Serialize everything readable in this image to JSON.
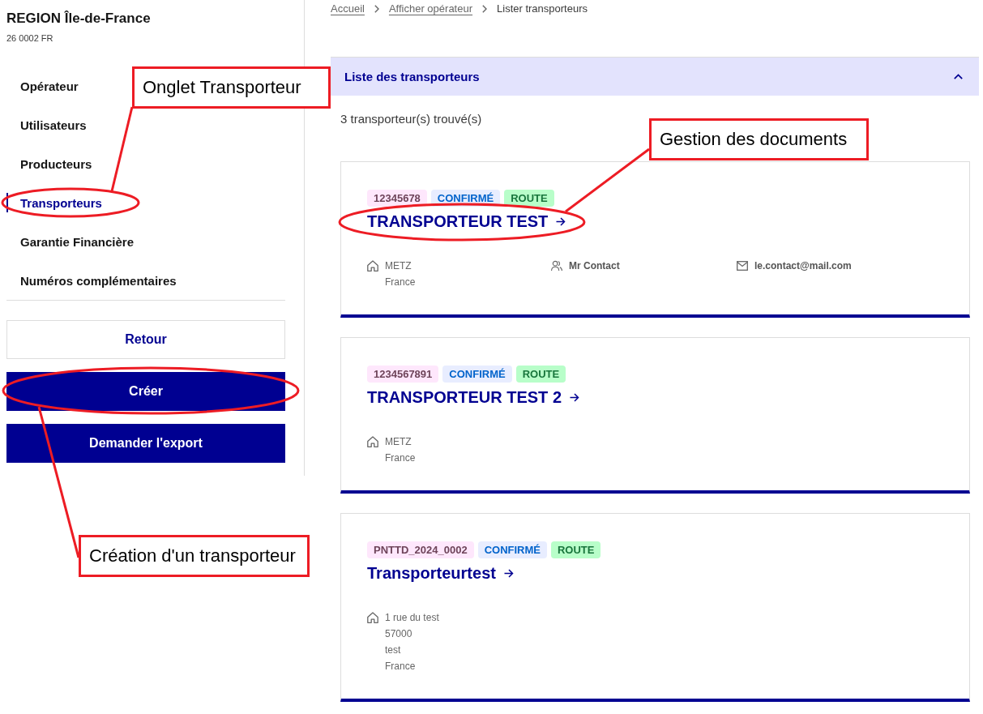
{
  "sidebar": {
    "title": "REGION Île-de-France",
    "subtitle": "26 0002 FR",
    "nav": [
      {
        "label": "Opérateur",
        "selected": false
      },
      {
        "label": "Utilisateurs",
        "selected": false
      },
      {
        "label": "Producteurs",
        "selected": false
      },
      {
        "label": "Transporteurs",
        "selected": true
      },
      {
        "label": "Garantie Financière",
        "selected": false
      },
      {
        "label": "Numéros complémentaires",
        "selected": false
      }
    ],
    "buttons": [
      {
        "label": "Retour",
        "kind": "secondary"
      },
      {
        "label": "Créer",
        "kind": "primary"
      },
      {
        "label": "Demander l'export",
        "kind": "primary"
      }
    ]
  },
  "breadcrumb": [
    {
      "label": "Accueil",
      "current": false
    },
    {
      "label": "Afficher opérateur",
      "current": false
    },
    {
      "label": "Lister transporteurs",
      "current": true
    }
  ],
  "panel": {
    "title": "Liste des transporteurs",
    "expanded": true,
    "count": "3 transporteur(s) trouvé(s)",
    "cards": [
      {
        "tags": [
          {
            "text": "12345678",
            "kind": "number"
          },
          {
            "text": "CONFIRMÉ",
            "kind": "status"
          },
          {
            "text": "ROUTE",
            "kind": "mode"
          }
        ],
        "name": "TRANSPORTEUR TEST",
        "address": [
          "METZ",
          "France"
        ],
        "contact": "Mr Contact",
        "email": "le.contact@mail.com"
      },
      {
        "tags": [
          {
            "text": "1234567891",
            "kind": "number"
          },
          {
            "text": "CONFIRMÉ",
            "kind": "status"
          },
          {
            "text": "ROUTE",
            "kind": "mode"
          }
        ],
        "name": "TRANSPORTEUR TEST 2",
        "address": [
          "METZ",
          "France"
        ]
      },
      {
        "tags": [
          {
            "text": "PNTTD_2024_0002",
            "kind": "number"
          },
          {
            "text": "CONFIRMÉ",
            "kind": "status"
          },
          {
            "text": "ROUTE",
            "kind": "mode"
          }
        ],
        "name": "Transporteurtest",
        "address": [
          "1 rue du test",
          "57000",
          "test",
          "France"
        ]
      }
    ]
  },
  "annotations": [
    {
      "text": "Onglet Transporteur"
    },
    {
      "text": "Gestion des documents"
    },
    {
      "text": "Création d'un transporteur"
    }
  ]
}
